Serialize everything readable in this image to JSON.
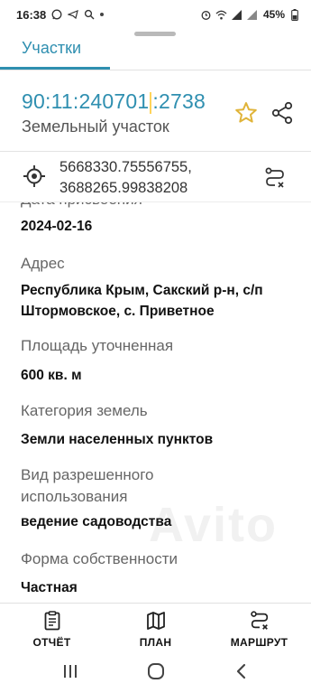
{
  "status_bar": {
    "time": "16:38",
    "battery": "45%"
  },
  "tabs": {
    "active": "Участки"
  },
  "parcel": {
    "cadastral_part1": "90:11:240701",
    "cadastral_part2": ":2738",
    "type": "Земельный участок"
  },
  "coordinates": {
    "line1": "5668330.75556755,",
    "line2": "3688265.99838208"
  },
  "fields": [
    {
      "label": "Дата присвоения",
      "value": "2024-02-16"
    },
    {
      "label": "Адрес",
      "value_line1": "Республика Крым, Сакский р-н, с/п",
      "value_line2": "Штормовское, с. Приветное"
    },
    {
      "label": "Площадь уточненная",
      "value": "600 кв. м"
    },
    {
      "label": "Категория земель",
      "value": "Земли населенных пунктов"
    },
    {
      "label_line1": "Вид разрешенного",
      "label_line2": "использования",
      "value": "ведение садоводства"
    },
    {
      "label": "Форма собственности",
      "value": "Частная"
    }
  ],
  "bottom_nav": {
    "report": "ОТЧЁТ",
    "plan": "ПЛАН",
    "route": "МАРШРУТ"
  },
  "colors": {
    "accent": "#2f8fb0",
    "star": "#e0b43a"
  },
  "icons": [
    "star-icon",
    "share-icon",
    "crosshair-icon",
    "route-icon",
    "report-icon",
    "map-icon",
    "recent-apps-icon",
    "home-icon",
    "back-icon"
  ]
}
